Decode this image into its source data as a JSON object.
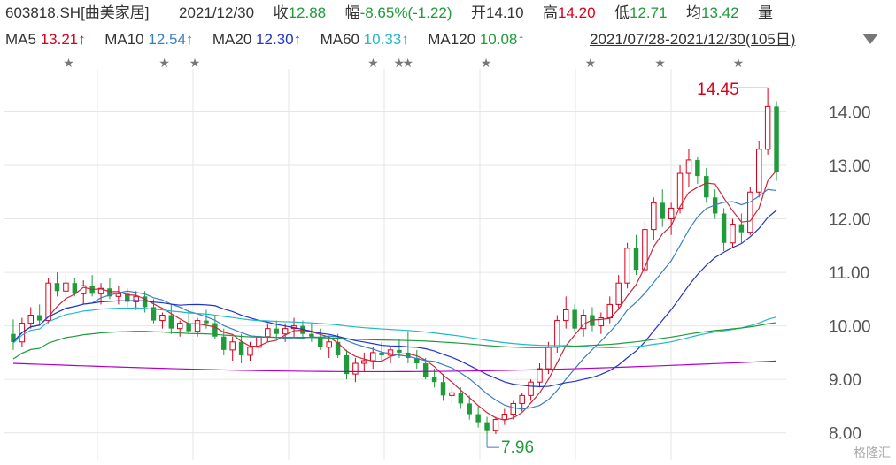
{
  "header": {
    "code": "603818.SH",
    "name": "[曲美家居]",
    "date": "2021/12/30",
    "close_label": "收",
    "close": "12.88",
    "change_label": "幅",
    "change": "-8.65%(-1.22)",
    "open_label": "开",
    "open": "14.10",
    "high_label": "高",
    "high": "14.20",
    "low_label": "低",
    "low": "12.71",
    "avg_label": "均",
    "avg": "13.42",
    "vol_label": "量"
  },
  "ma_bar": {
    "ma5": {
      "label": "MA5",
      "value": "13.21↑"
    },
    "ma10": {
      "label": "MA10",
      "value": "12.54↑"
    },
    "ma20": {
      "label": "MA20",
      "value": "12.30↑"
    },
    "ma60": {
      "label": "MA60",
      "value": "10.33↑"
    },
    "ma120": {
      "label": "MA120",
      "value": "10.08↑"
    },
    "overlap_text": "2021/07/28-2021/12/30(105日)"
  },
  "colors": {
    "up": "#d9001b",
    "down": "#1f9b3b",
    "ma5": "#c8283c",
    "ma10": "#3a7fc1",
    "ma20": "#2233cc",
    "ma60": "#23b8c8",
    "ma120": "#1f9b3b",
    "ma250": "#b100c8",
    "grid": "#e6e6e6"
  },
  "watermark": "格隆汇",
  "chart_data": {
    "type": "candlestick",
    "y_ticks": [
      "14.00",
      "13.00",
      "12.00",
      "11.00",
      "10.00",
      "9.00",
      "8.00"
    ],
    "ylim": [
      7.5,
      14.8
    ],
    "annotations": [
      {
        "text": "14.45",
        "type": "max"
      },
      {
        "text": "7.96",
        "type": "min"
      }
    ],
    "candles": [
      [
        9.85,
        10.12,
        9.55,
        9.7
      ],
      [
        9.7,
        10.15,
        9.6,
        10.05
      ],
      [
        10.05,
        10.35,
        9.95,
        10.2
      ],
      [
        10.2,
        10.4,
        10.0,
        10.1
      ],
      [
        10.1,
        10.9,
        10.05,
        10.8
      ],
      [
        10.8,
        11.0,
        10.55,
        10.65
      ],
      [
        10.65,
        10.95,
        10.5,
        10.8
      ],
      [
        10.8,
        10.9,
        10.55,
        10.6
      ],
      [
        10.6,
        10.85,
        10.4,
        10.75
      ],
      [
        10.75,
        10.95,
        10.55,
        10.6
      ],
      [
        10.6,
        10.8,
        10.4,
        10.7
      ],
      [
        10.7,
        10.9,
        10.5,
        10.55
      ],
      [
        10.55,
        10.75,
        10.4,
        10.6
      ],
      [
        10.6,
        10.7,
        10.35,
        10.45
      ],
      [
        10.45,
        10.65,
        10.3,
        10.55
      ],
      [
        10.55,
        10.65,
        10.25,
        10.35
      ],
      [
        10.35,
        10.5,
        10.05,
        10.1
      ],
      [
        10.1,
        10.25,
        9.95,
        10.2
      ],
      [
        10.2,
        10.4,
        9.85,
        9.95
      ],
      [
        9.95,
        10.1,
        9.8,
        10.05
      ],
      [
        10.05,
        10.3,
        9.85,
        9.9
      ],
      [
        9.9,
        10.15,
        9.8,
        10.1
      ],
      [
        10.1,
        10.3,
        9.95,
        10.05
      ],
      [
        10.05,
        10.2,
        9.75,
        9.8
      ],
      [
        9.8,
        9.95,
        9.45,
        9.55
      ],
      [
        9.55,
        9.8,
        9.35,
        9.7
      ],
      [
        9.7,
        9.85,
        9.3,
        9.45
      ],
      [
        9.45,
        9.7,
        9.35,
        9.6
      ],
      [
        9.6,
        9.85,
        9.5,
        9.8
      ],
      [
        9.8,
        10.05,
        9.7,
        9.95
      ],
      [
        9.95,
        10.1,
        9.75,
        9.85
      ],
      [
        9.85,
        10.05,
        9.7,
        9.95
      ],
      [
        9.95,
        10.15,
        9.8,
        10.0
      ],
      [
        10.0,
        10.1,
        9.75,
        9.85
      ],
      [
        9.85,
        10.05,
        9.7,
        9.8
      ],
      [
        9.8,
        9.95,
        9.55,
        9.6
      ],
      [
        9.6,
        9.8,
        9.4,
        9.7
      ],
      [
        9.7,
        9.85,
        9.4,
        9.45
      ],
      [
        9.45,
        9.55,
        9.0,
        9.1
      ],
      [
        9.1,
        9.4,
        8.95,
        9.3
      ],
      [
        9.3,
        9.5,
        9.15,
        9.35
      ],
      [
        9.35,
        9.6,
        9.2,
        9.5
      ],
      [
        9.5,
        9.7,
        9.35,
        9.45
      ],
      [
        9.45,
        9.6,
        9.3,
        9.55
      ],
      [
        9.55,
        9.75,
        9.4,
        9.5
      ],
      [
        9.5,
        9.9,
        9.3,
        9.4
      ],
      [
        9.4,
        9.55,
        9.2,
        9.3
      ],
      [
        9.3,
        9.4,
        9.0,
        9.05
      ],
      [
        9.05,
        9.2,
        8.85,
        8.95
      ],
      [
        8.95,
        9.1,
        8.6,
        8.7
      ],
      [
        8.7,
        8.9,
        8.55,
        8.75
      ],
      [
        8.75,
        8.85,
        8.45,
        8.55
      ],
      [
        8.55,
        8.7,
        8.25,
        8.35
      ],
      [
        8.35,
        8.5,
        8.1,
        8.2
      ],
      [
        8.2,
        8.3,
        7.96,
        8.05
      ],
      [
        8.05,
        8.3,
        7.98,
        8.25
      ],
      [
        8.25,
        8.45,
        8.15,
        8.35
      ],
      [
        8.35,
        8.6,
        8.25,
        8.55
      ],
      [
        8.55,
        8.75,
        8.4,
        8.7
      ],
      [
        8.7,
        9.0,
        8.6,
        8.95
      ],
      [
        8.95,
        9.3,
        8.85,
        9.2
      ],
      [
        9.2,
        9.7,
        9.1,
        9.6
      ],
      [
        9.6,
        10.2,
        9.5,
        10.1
      ],
      [
        10.1,
        10.55,
        9.95,
        10.3
      ],
      [
        10.3,
        10.4,
        9.9,
        9.95
      ],
      [
        9.95,
        10.3,
        9.8,
        10.2
      ],
      [
        10.2,
        10.35,
        9.9,
        10.0
      ],
      [
        10.0,
        10.25,
        9.85,
        10.15
      ],
      [
        10.15,
        10.55,
        10.05,
        10.4
      ],
      [
        10.4,
        10.95,
        10.3,
        10.8
      ],
      [
        10.8,
        11.55,
        10.7,
        11.45
      ],
      [
        11.45,
        11.7,
        10.95,
        11.05
      ],
      [
        11.05,
        11.95,
        10.95,
        11.8
      ],
      [
        11.8,
        12.4,
        11.6,
        12.3
      ],
      [
        12.3,
        12.55,
        11.85,
        12.0
      ],
      [
        12.0,
        12.3,
        11.7,
        12.2
      ],
      [
        12.2,
        13.0,
        12.1,
        12.85
      ],
      [
        12.85,
        13.3,
        12.6,
        13.1
      ],
      [
        13.1,
        13.15,
        12.65,
        12.8
      ],
      [
        12.8,
        12.95,
        12.3,
        12.4
      ],
      [
        12.4,
        12.55,
        12.0,
        12.1
      ],
      [
        12.1,
        12.2,
        11.4,
        11.55
      ],
      [
        11.55,
        12.0,
        11.45,
        11.9
      ],
      [
        11.9,
        12.1,
        11.55,
        11.75
      ],
      [
        11.75,
        12.6,
        11.7,
        12.5
      ],
      [
        12.5,
        13.45,
        12.4,
        13.3
      ],
      [
        13.3,
        14.45,
        13.2,
        14.1
      ],
      [
        14.1,
        14.2,
        12.71,
        12.88
      ]
    ]
  }
}
